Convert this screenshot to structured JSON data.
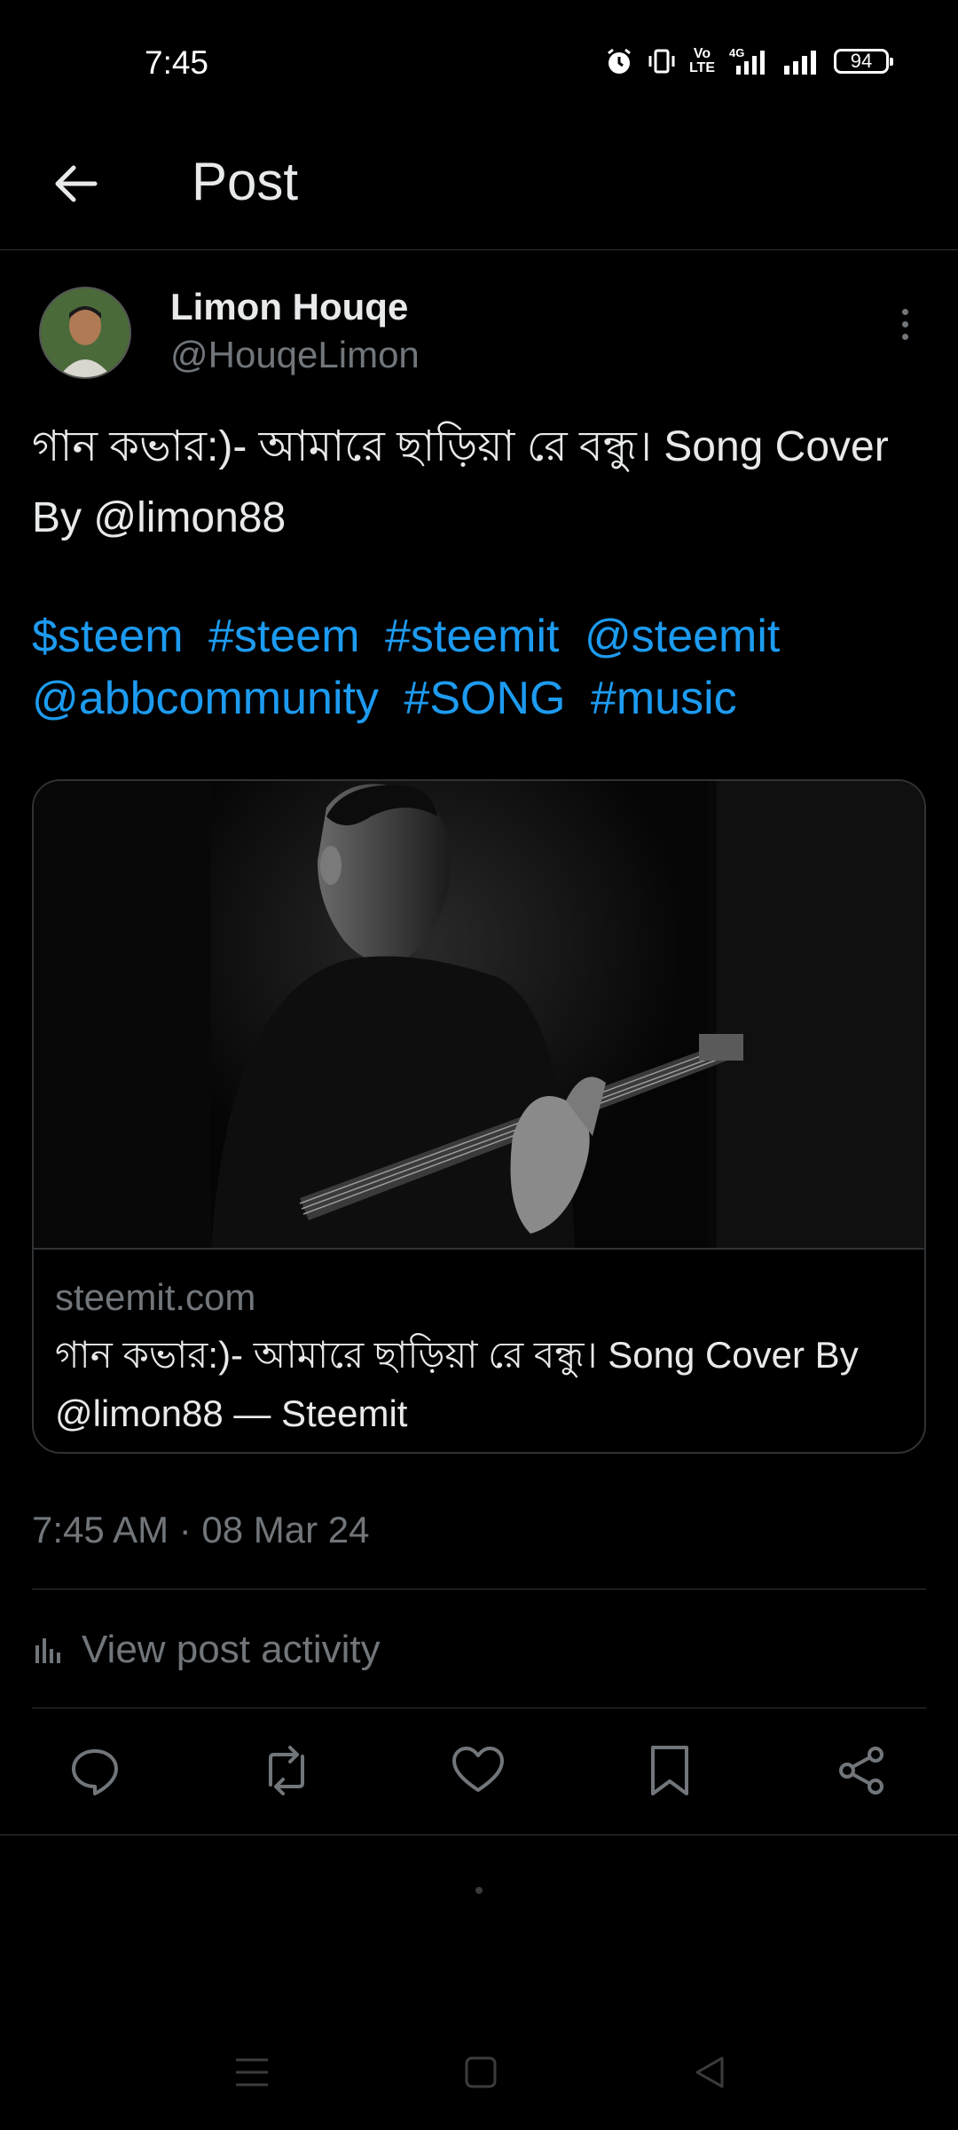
{
  "status_bar": {
    "time": "7:45",
    "network": "4G",
    "volte": "VoLTE2",
    "battery": "94",
    "icons": [
      "alarm-icon",
      "vibrate-icon",
      "volte-icon",
      "signal-4g-icon",
      "signal-icon",
      "battery-icon"
    ]
  },
  "header": {
    "title": "Post",
    "back_icon": "arrow-left-icon"
  },
  "post": {
    "author_name": "Limon Houqe",
    "author_handle": "@HouqeLimon",
    "text": "গান কভার:)- আমারে ছাড়িয়া রে বন্ধু। Song Cover By @limon88",
    "tags": [
      "$steem",
      "#steem",
      "#steemit",
      "@steemit",
      "@abbcommunity",
      "#SONG",
      "#music"
    ],
    "timestamp": "7:45 AM · 08 Mar 24",
    "activity_label": "View post activity"
  },
  "card": {
    "domain": "steemit.com",
    "title": "গান কভার:)- আমারে ছাড়িয়া রে বন্ধু। Song Cover By @limon88 — Steemit",
    "image": "guitarist-photo"
  },
  "actions": [
    "reply-icon",
    "repost-icon",
    "like-icon",
    "bookmark-icon",
    "share-icon"
  ],
  "colors": {
    "background": "#000000",
    "text": "#e7e9ea",
    "secondary": "#71767b",
    "link": "#1d9bf0",
    "border": "#2f3336"
  }
}
